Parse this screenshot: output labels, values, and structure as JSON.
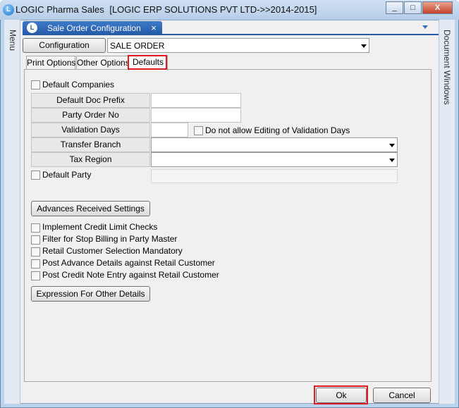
{
  "window": {
    "app_name": "LOGIC Pharma Sales",
    "company": "[LOGIC ERP SOLUTIONS PVT LTD->>2014-2015]",
    "min_glyph": "_",
    "max_glyph": "□",
    "close_glyph": "X"
  },
  "side": {
    "menu": "Menu",
    "documents": "Document Windows"
  },
  "doc_tab": {
    "title": "Sale Order Configuration",
    "close_glyph": "×"
  },
  "config": {
    "label": "Configuration",
    "value": "SALE ORDER"
  },
  "tabs": [
    "Print Options",
    "Other Options",
    "Defaults"
  ],
  "defaults": {
    "default_companies": "Default Companies",
    "fields": {
      "doc_prefix": {
        "label": "Default Doc Prefix",
        "value": ""
      },
      "party_order_no": {
        "label": "Party Order No",
        "value": ""
      },
      "validation_days": {
        "label": "Validation Days",
        "value": ""
      },
      "no_edit_validation": "Do not allow Editing of Validation Days",
      "transfer_branch": {
        "label": "Transfer Branch",
        "value": ""
      },
      "tax_region": {
        "label": "Tax Region",
        "value": ""
      }
    },
    "default_party": "Default Party",
    "advances_button": "Advances Received Settings",
    "checks": [
      "Implement Credit Limit Checks",
      "Filter for Stop Billing in Party Master",
      "Retail Customer Selection Mandatory",
      "Post Advance Details against Retail Customer",
      "Post Credit Note Entry against Retail Customer"
    ],
    "expression_button": "Expression For Other Details"
  },
  "buttons": {
    "ok": "Ok",
    "cancel": "Cancel"
  },
  "colors": {
    "highlight": "#e01b24",
    "doc_tab": "#245aa6"
  }
}
